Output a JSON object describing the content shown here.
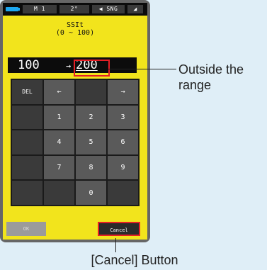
{
  "status_bar": {
    "mode": "M 1",
    "temperature": "2°",
    "sync": "SNG"
  },
  "title": {
    "line1": "SSIt",
    "line2": "(0 ~ 100)"
  },
  "display": {
    "current_value": "100",
    "arrow": "→",
    "new_value": "200"
  },
  "keypad": {
    "delete": "DEL",
    "left": "←",
    "right": "→",
    "k1": "1",
    "k2": "2",
    "k3": "3",
    "k4": "4",
    "k5": "5",
    "k6": "6",
    "k7": "7",
    "k8": "8",
    "k9": "9",
    "k0": "0"
  },
  "buttons": {
    "ok": "OK",
    "cancel": "Cancel"
  },
  "annotations": {
    "out_of_range": "Outside the range",
    "cancel_button": "[Cancel] Button"
  },
  "colors": {
    "screen_bg": "#f2e41c",
    "highlight": "#e51f25",
    "battery": "#1ea8f0"
  }
}
